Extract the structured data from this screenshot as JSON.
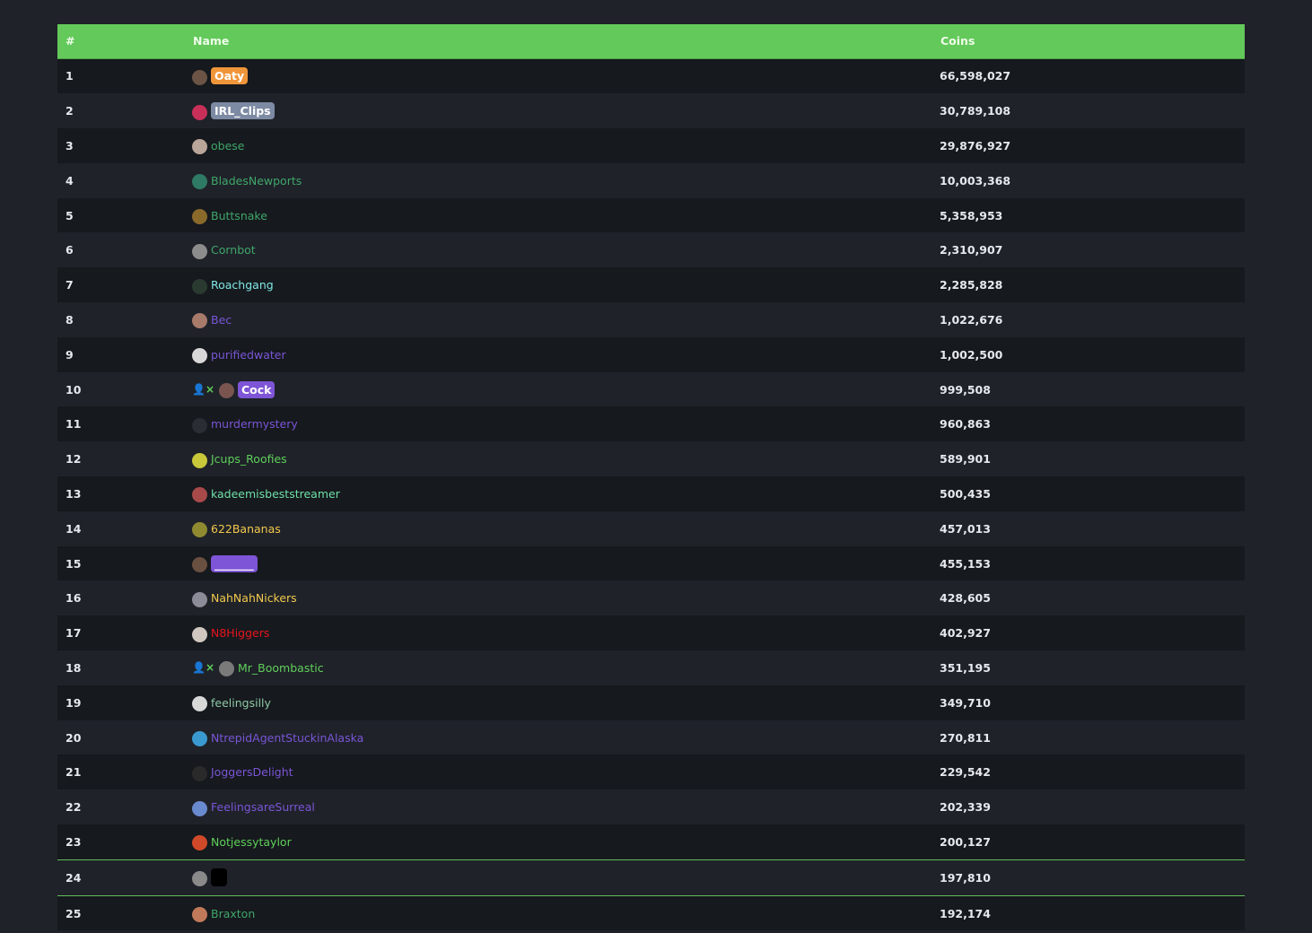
{
  "header": {
    "rank": "#",
    "name": "Name",
    "coins": "Coins"
  },
  "rows": [
    {
      "rank": "1",
      "name": "Oaty",
      "coins": "66,598,027",
      "color": "#ffffff",
      "badge": "#f0963a",
      "avatar": "#6b5446"
    },
    {
      "rank": "2",
      "name": "IRL_Clips",
      "coins": "30,789,108",
      "color": "#ffffff",
      "badge": "#7d8aa3",
      "avatar": "#c8305a"
    },
    {
      "rank": "3",
      "name": "obese",
      "coins": "29,876,927",
      "color": "#3fa66a",
      "avatar": "#b9a59a"
    },
    {
      "rank": "4",
      "name": "BladesNewports",
      "coins": "10,003,368",
      "color": "#3fa66a",
      "avatar": "#2f7a64"
    },
    {
      "rank": "5",
      "name": "Buttsnake",
      "coins": "5,358,953",
      "color": "#3fa66a",
      "avatar": "#8a6a2a"
    },
    {
      "rank": "6",
      "name": "Cornbot",
      "coins": "2,310,907",
      "color": "#3fa66a",
      "avatar": "#8c8c8c"
    },
    {
      "rank": "7",
      "name": "Roachgang",
      "coins": "2,285,828",
      "color": "#7fe6e6",
      "avatar": "#2a3a30"
    },
    {
      "rank": "8",
      "name": "Bec",
      "coins": "1,022,676",
      "color": "#7a55d6",
      "avatar": "#a87a6a"
    },
    {
      "rank": "9",
      "name": "purifiedwater",
      "coins": "1,002,500",
      "color": "#7a55d6",
      "avatar": "#d8d8d8"
    },
    {
      "rank": "10",
      "name": "Cock",
      "coins": "999,508",
      "color": "#ffffff",
      "badge": "#7e55d6",
      "avatar": "#7a5550",
      "follow": true
    },
    {
      "rank": "11",
      "name": "murdermystery",
      "coins": "960,863",
      "color": "#7a55d6",
      "avatar": "#2a2d33"
    },
    {
      "rank": "12",
      "name": "Jcups_Roofies",
      "coins": "589,901",
      "color": "#5fcf5a",
      "avatar": "#c8c83a"
    },
    {
      "rank": "13",
      "name": "kadeemisbeststreamer",
      "coins": "500,435",
      "color": "#6fe0a8",
      "avatar": "#a84a4a"
    },
    {
      "rank": "14",
      "name": "622Bananas",
      "coins": "457,013",
      "color": "#f2c94c",
      "avatar": "#8f8a30"
    },
    {
      "rank": "15",
      "name": "_______",
      "coins": "455,153",
      "color": "#ffffff",
      "badge": "#7e55d6",
      "avatar": "#6a5040"
    },
    {
      "rank": "16",
      "name": "NahNahNickers",
      "coins": "428,605",
      "color": "#f2c94c",
      "avatar": "#8c8c99"
    },
    {
      "rank": "17",
      "name": "N8Higgers",
      "coins": "402,927",
      "color": "#e8141e",
      "avatar": "#d0c8c0"
    },
    {
      "rank": "18",
      "name": "Mr_Boombastic",
      "coins": "351,195",
      "color": "#5fcf5a",
      "avatar": "#7a7a7a",
      "follow": true
    },
    {
      "rank": "19",
      "name": "feelingsilly",
      "coins": "349,710",
      "color": "#8fc9a8",
      "avatar": "#d8d8d8"
    },
    {
      "rank": "20",
      "name": "NtrepidAgentStuckinAlaska",
      "coins": "270,811",
      "color": "#7a55d6",
      "avatar": "#3a9ad0"
    },
    {
      "rank": "21",
      "name": "JoggersDelight",
      "coins": "229,542",
      "color": "#7a55d6",
      "avatar": "#2a2a2a"
    },
    {
      "rank": "22",
      "name": "FeelingsareSurreal",
      "coins": "202,339",
      "color": "#7a55d6",
      "avatar": "#6a8ad0"
    },
    {
      "rank": "23",
      "name": "Notjessytaylor",
      "coins": "200,127",
      "color": "#5fcf5a",
      "avatar": "#d04a2a"
    },
    {
      "rank": "24",
      "name": "",
      "coins": "197,810",
      "color": "#ffffff",
      "badge": "#000000",
      "avatar": "#8a8a8a",
      "highlight": true
    },
    {
      "rank": "25",
      "name": "Braxton",
      "coins": "192,174",
      "color": "#3fa66a",
      "avatar": "#c07a5a"
    }
  ]
}
